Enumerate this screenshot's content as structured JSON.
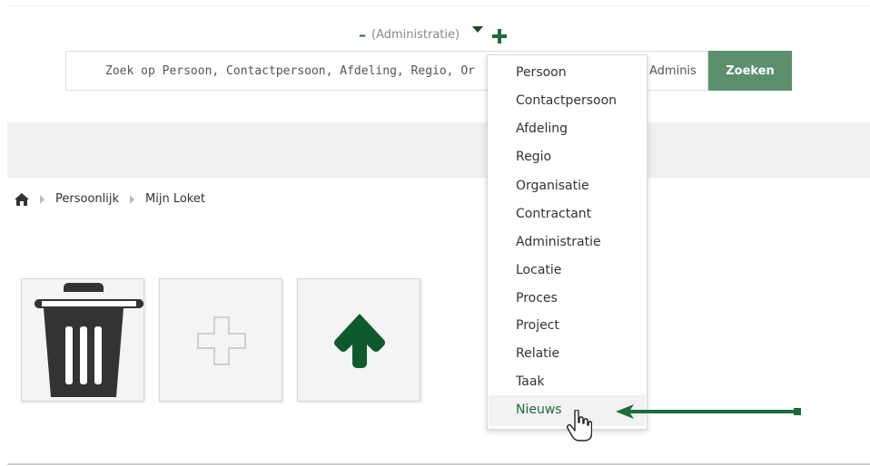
{
  "header": {
    "minus_label": "–",
    "scope_label": "(Administratie)"
  },
  "search": {
    "placeholder": "Zoek op Persoon, Contactpersoon, Afdeling, Regio, Or",
    "trailing_visible_text": "Adminis",
    "button_label": "Zoeken"
  },
  "breadcrumb": {
    "items": [
      "Persoonlijk",
      "Mijn Loket"
    ]
  },
  "dropdown": {
    "items": [
      "Persoon",
      "Contactpersoon",
      "Afdeling",
      "Regio",
      "Organisatie",
      "Contractant",
      "Administratie",
      "Locatie",
      "Proces",
      "Project",
      "Relatie",
      "Taak",
      "Nieuws"
    ],
    "active_item": "Nieuws"
  },
  "tiles": {
    "icons": [
      "trash-icon",
      "plus-icon",
      "arrow-up-icon"
    ]
  },
  "colors": {
    "accent_green": "#1e6b3c",
    "button_green": "#5b8f6e",
    "band_gray": "#f0f0f0"
  }
}
